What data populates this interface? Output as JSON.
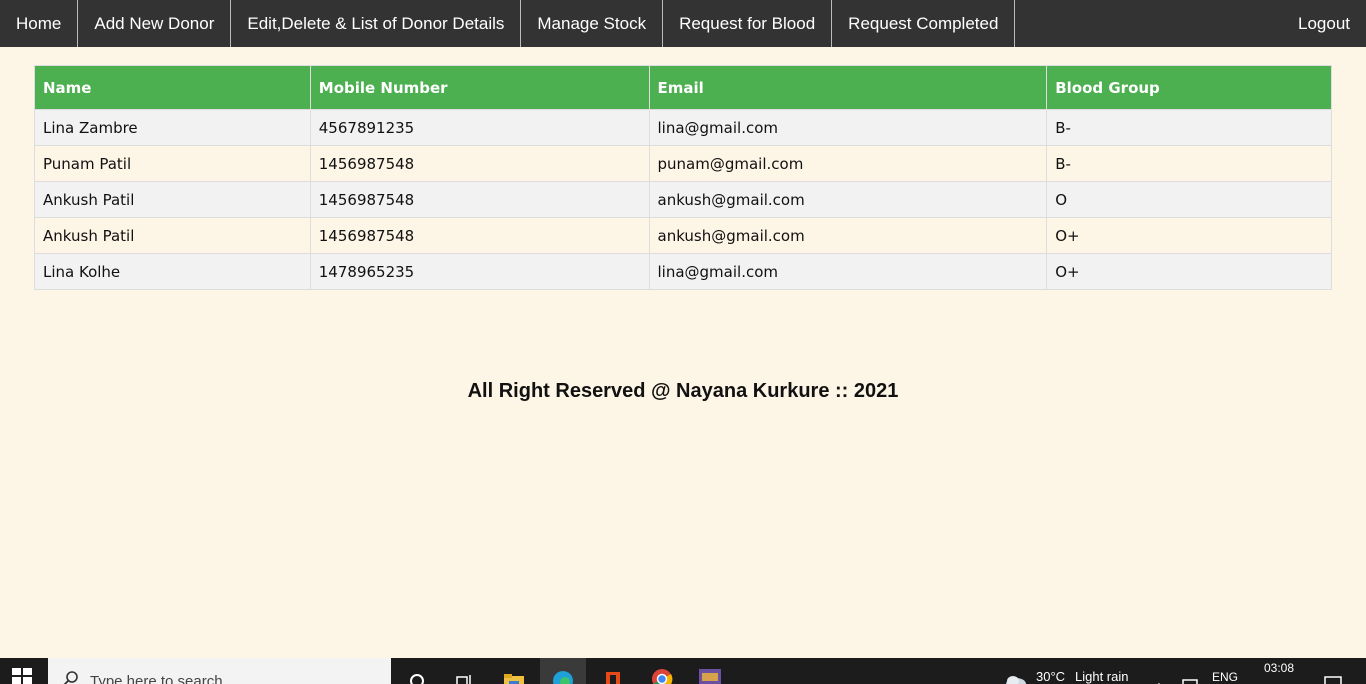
{
  "nav": {
    "items": [
      {
        "label": "Home"
      },
      {
        "label": "Add New Donor"
      },
      {
        "label": "Edit,Delete & List of Donor Details"
      },
      {
        "label": "Manage Stock"
      },
      {
        "label": "Request for Blood"
      },
      {
        "label": "Request Completed"
      }
    ],
    "logout": "Logout"
  },
  "table": {
    "headers": [
      "Name",
      "Mobile Number",
      "Email",
      "Blood Group"
    ],
    "rows": [
      [
        "Lina Zambre",
        "4567891235",
        "lina@gmail.com",
        "B-"
      ],
      [
        "Punam Patil",
        "1456987548",
        "punam@gmail.com",
        "B-"
      ],
      [
        "Ankush Patil",
        "1456987548",
        "ankush@gmail.com",
        "O"
      ],
      [
        "Ankush Patil",
        "1456987548",
        "ankush@gmail.com",
        "O+"
      ],
      [
        "Lina Kolhe",
        "1478965235",
        "lina@gmail.com",
        "O+"
      ]
    ]
  },
  "footer": {
    "text": "All Right Reserved @ Nayana Kurkure :: 2021"
  },
  "taskbar": {
    "search_placeholder": "Type here to search",
    "weather_temp": "30°C",
    "weather_desc": "Light rain",
    "language": "ENG",
    "time": "03:08"
  },
  "colors": {
    "navbar": "#333333",
    "table_header": "#4caf50",
    "page_background": "#fdf5e6"
  }
}
